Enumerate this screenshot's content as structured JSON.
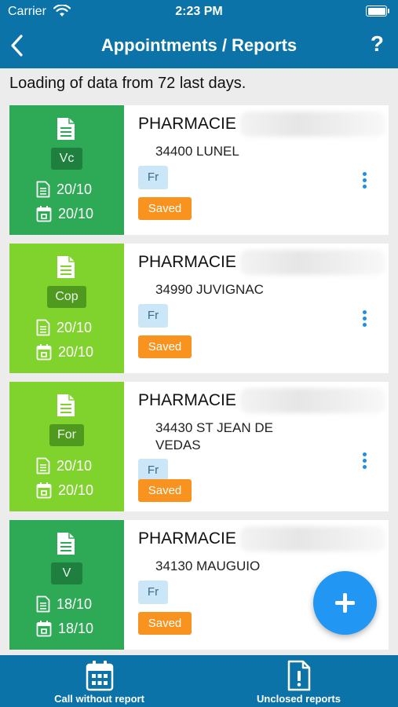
{
  "status_bar": {
    "carrier": "Carrier",
    "time": "2:23 PM"
  },
  "nav": {
    "title": "Appointments / Reports",
    "help": "?"
  },
  "loading_text": "Loading of data from 72 last days.",
  "cards": [
    {
      "code": "Vc",
      "side_color": "#2eaa57",
      "code_bg": "#1f7f3f",
      "date1": "20/10",
      "date2": "20/10",
      "name": "PHARMACIE",
      "address": "34400 LUNEL",
      "lang": "Fr",
      "status": "Saved"
    },
    {
      "code": "Cop",
      "side_color": "#7fd32c",
      "code_bg": "#4f9a1e",
      "date1": "20/10",
      "date2": "20/10",
      "name": "PHARMACIE",
      "address": "34990 JUVIGNAC",
      "lang": "Fr",
      "status": "Saved"
    },
    {
      "code": "For",
      "side_color": "#7fd32c",
      "code_bg": "#4f9a1e",
      "date1": "20/10",
      "date2": "20/10",
      "name": "PHARMACIE",
      "address": "34430 ST JEAN DE VEDAS",
      "lang": "Fr",
      "status": "Saved"
    },
    {
      "code": "V",
      "side_color": "#2eaa57",
      "code_bg": "#1f7f3f",
      "date1": "18/10",
      "date2": "18/10",
      "name": "PHARMACIE",
      "address": "34130 MAUGUIO",
      "lang": "Fr",
      "status": "Saved"
    }
  ],
  "tabs": [
    {
      "label": "Call without report",
      "icon": "calendar-icon"
    },
    {
      "label": "Unclosed reports",
      "icon": "document-alert-icon"
    }
  ],
  "colors": {
    "primary": "#0b73a8",
    "saved": "#f7931e",
    "lang_badge": "#cbe6f7",
    "fab": "#2196f3"
  }
}
